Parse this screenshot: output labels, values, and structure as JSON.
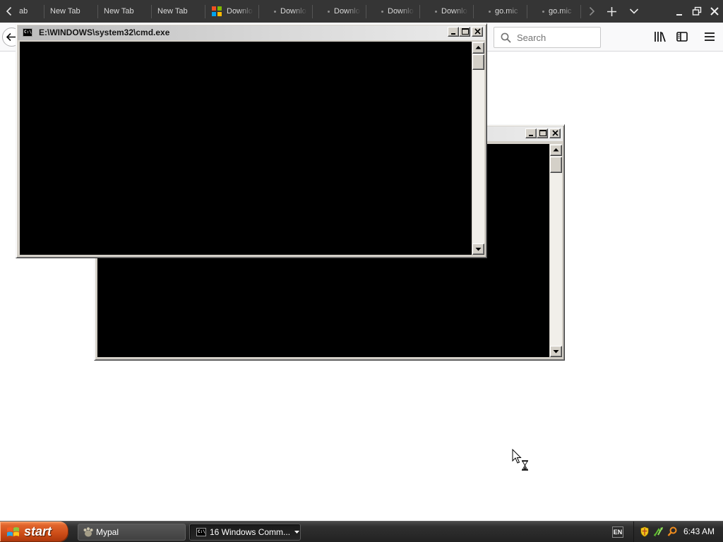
{
  "colors": {
    "tab_bar_bg": "#353535",
    "toolbar_bg": "#f9f9fa",
    "console_bg": "#000000",
    "window_frame": "#d4d0c8",
    "taskbar_bg": "#2a2a2a",
    "start_button": "#d4501a"
  },
  "browser": {
    "tab_strip": {
      "scroll_left_icon": "chevron-left-icon",
      "tabs": [
        {
          "label": "ab"
        },
        {
          "label": "New Tab"
        },
        {
          "label": "New Tab"
        },
        {
          "label": "New Tab"
        },
        {
          "label": "Downlo",
          "icon": "microsoft-logo-icon"
        },
        {
          "label": "Downlo",
          "icon": "dot-icon"
        },
        {
          "label": "Downlo",
          "icon": "dot-icon"
        },
        {
          "label": "Downlo",
          "icon": "dot-icon"
        },
        {
          "label": "Downlo",
          "icon": "dot-icon"
        },
        {
          "label": "go.mic",
          "icon": "dot-icon"
        },
        {
          "label": "go.mic",
          "icon": "dot-icon"
        }
      ],
      "scroll_right_icon": "chevron-right-icon",
      "new_tab_icon": "plus-icon",
      "list_all_tabs_icon": "chevron-down-icon"
    },
    "window_controls": [
      "minimize-icon",
      "restore-icon",
      "close-icon"
    ],
    "toolbar": {
      "back_icon": "back-arrow-icon",
      "search_icon": "search-icon",
      "search_placeholder": "Search",
      "library_icon": "library-icon",
      "sidebar_icon": "sidebar-icon",
      "menu_icon": "hamburger-menu-icon"
    }
  },
  "cmd_windows": [
    {
      "title": "E:\\WINDOWS\\system32\\cmd.exe",
      "icon": "cmd-icon",
      "icon_text": "C:\\"
    },
    {
      "icon": "cmd-icon"
    }
  ],
  "taskbar": {
    "start_label": "start",
    "start_icon": "windows-logo-icon",
    "buttons": [
      {
        "label": "Mypal",
        "icon": "mypal-icon"
      },
      {
        "label": "16 Windows Comm...",
        "icon": "cmd-icon",
        "icon_text": "C:\\",
        "menu_icon": "dropdown-arrow-icon"
      }
    ],
    "language": "EN",
    "tray_icons": [
      "security-shield-icon",
      "network-icon",
      "search-tray-icon"
    ],
    "clock": "6:43 AM"
  },
  "cursor": {
    "icon": "busy-arrow-cursor-icon"
  }
}
